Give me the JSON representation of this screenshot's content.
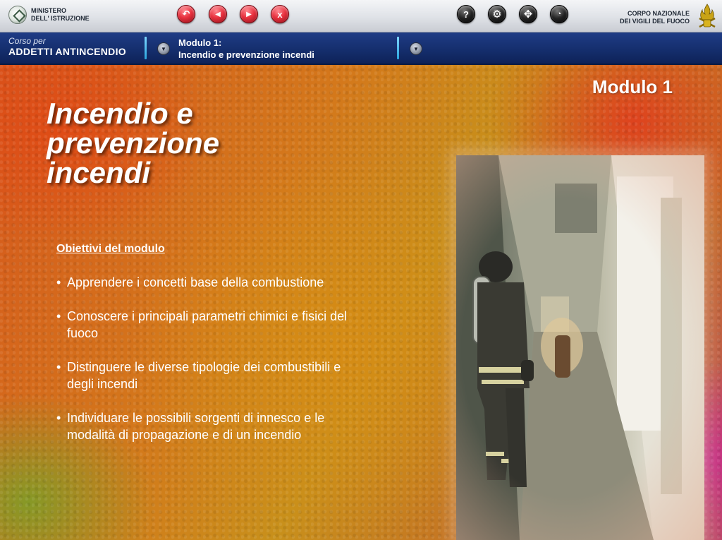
{
  "topbar": {
    "ministry_line1": "MINISTERO",
    "ministry_line2": "DELL' ISTRUZIONE",
    "corps_line1": "CORPO NAZIONALE",
    "corps_line2": "DEI VIGILI DEL FUOCO",
    "nav_buttons": [
      {
        "name": "back-icon",
        "glyph": "↶"
      },
      {
        "name": "previous-icon",
        "glyph": "◀"
      },
      {
        "name": "next-icon",
        "glyph": "▶"
      },
      {
        "name": "close-icon",
        "glyph": "x"
      }
    ],
    "tool_buttons": [
      {
        "name": "help-icon",
        "glyph": "?"
      },
      {
        "name": "settings-gear-icon",
        "glyph": "⚙"
      },
      {
        "name": "navigation-arrows-icon",
        "glyph": "✥"
      },
      {
        "name": "audio-icon",
        "glyph": "◔"
      }
    ]
  },
  "coursebar": {
    "course_small": "Corso per",
    "course_big": "ADDETTI ANTINCENDIO",
    "module_line1": "Modulo 1:",
    "module_line2": "Incendio e prevenzione incendi",
    "dropdown_glyph": "▼"
  },
  "main": {
    "module_number": "Modulo 1",
    "title_line1": "Incendio e",
    "title_line2": "prevenzione",
    "title_line3": "incendi",
    "objectives_heading": "Obiettivi del modulo",
    "bullet": "•",
    "objectives": [
      "Apprendere i concetti base della combustione",
      "Conoscere i principali parametri chimici e fisici del fuoco",
      "Distinguere le diverse tipologie dei combustibili e degli incendi",
      "Individuare le possibili sorgenti di innesco e le modalità di propagazione e di un incendio"
    ]
  },
  "colors": {
    "red_button": "#e8323f",
    "course_bar": "#142d6b",
    "separator": "#2aa6de"
  }
}
